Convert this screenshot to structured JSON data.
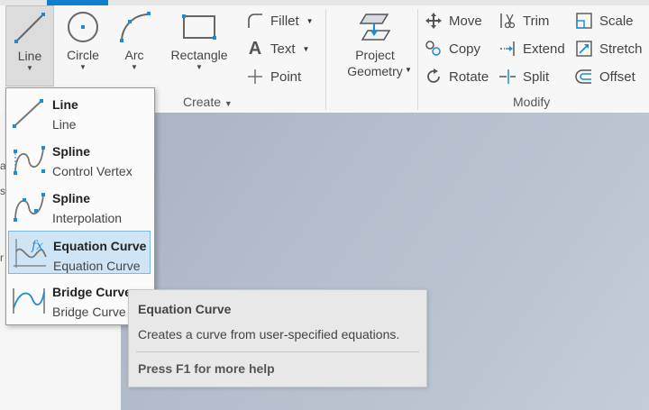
{
  "ribbon": {
    "create": {
      "title": "Create",
      "line": "Line",
      "circle": "Circle",
      "arc": "Arc",
      "rectangle": "Rectangle",
      "fillet": "Fillet",
      "text": "Text",
      "point": "Point"
    },
    "project_geometry": {
      "line1": "Project",
      "line2": "Geometry"
    },
    "modify": {
      "title": "Modify",
      "move": "Move",
      "copy": "Copy",
      "rotate": "Rotate",
      "trim": "Trim",
      "extend": "Extend",
      "split": "Split",
      "scale": "Scale",
      "stretch": "Stretch",
      "offset": "Offset"
    }
  },
  "dropdown": {
    "items": [
      {
        "title": "Line",
        "subtitle": "Line",
        "icon": "line-icon"
      },
      {
        "title": "Spline",
        "subtitle": "Control Vertex",
        "icon": "spline-cv-icon"
      },
      {
        "title": "Spline",
        "subtitle": "Interpolation",
        "icon": "spline-interp-icon"
      },
      {
        "title": "Equation Curve",
        "subtitle": "Equation Curve",
        "icon": "equation-curve-icon",
        "highlighted": true
      },
      {
        "title": "Bridge Curve",
        "subtitle": "Bridge Curve",
        "icon": "bridge-curve-icon"
      }
    ]
  },
  "tooltip": {
    "title": "Equation Curve",
    "description": "Creates a curve from user-specified equations.",
    "help": "Press F1 for more help"
  },
  "colors": {
    "accent": "#0e7fd1",
    "highlight_bg": "#cfe5f6",
    "highlight_border": "#7fb8e2",
    "icon_blue": "#1f8ad6"
  }
}
